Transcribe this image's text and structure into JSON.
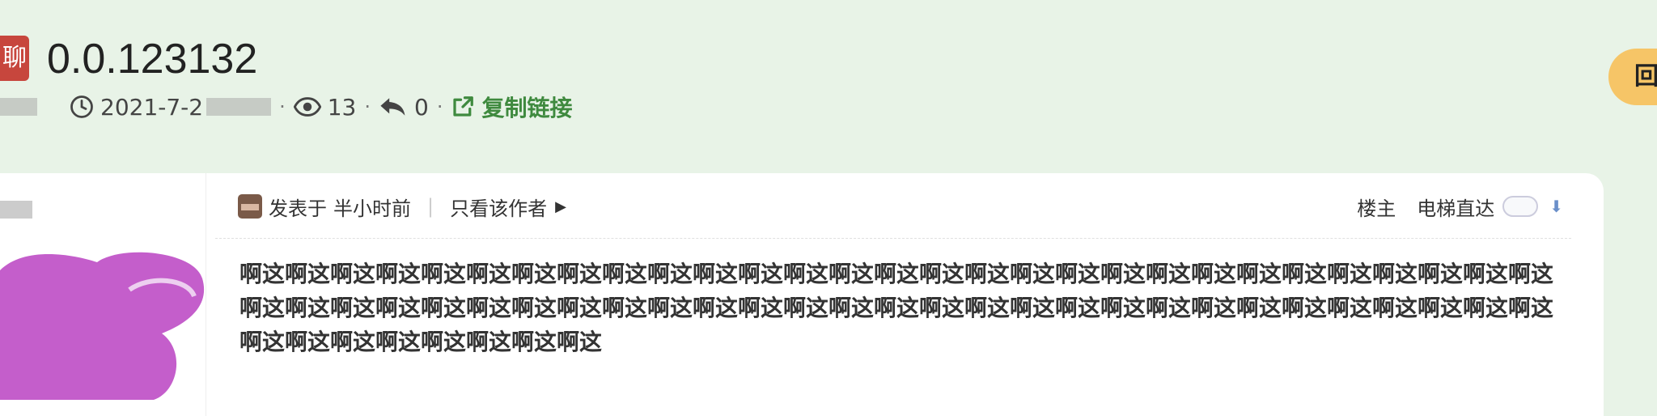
{
  "topic": {
    "category_badge": "聊",
    "title": "0.0.123132",
    "date": "2021-7-2",
    "views": "13",
    "replies": "0",
    "copy_link": "复制链接"
  },
  "reply_button": {
    "label": "回"
  },
  "post": {
    "posted_prefix": "发表于",
    "posted_time": "半小时前",
    "only_author": "只看该作者",
    "floor_label": "楼主",
    "elevator_label": "电梯直达",
    "body": "啊这啊这啊这啊这啊这啊这啊这啊这啊这啊这啊这啊这啊这啊这啊这啊这啊这啊这啊这啊这啊这啊这啊这啊这啊这啊这啊这啊这啊这啊这啊这啊这啊这啊这啊这啊这啊这啊这啊这啊这啊这啊这啊这啊这啊这啊这啊这啊这啊这啊这啊这啊这啊这啊这啊这啊这啊这啊这啊这啊这啊这啊这啊这啊这啊这啊这"
  },
  "colors": {
    "page_bg": "#e8f3e7",
    "category_badge": "#c7463d",
    "link_green": "#3f8a3f",
    "reply_button": "#f6c567",
    "avatar_scribble": "#c45ecb"
  },
  "icons": [
    "clock-icon",
    "eye-icon",
    "reply-icon",
    "external-link-icon",
    "down-arrow-icon"
  ]
}
